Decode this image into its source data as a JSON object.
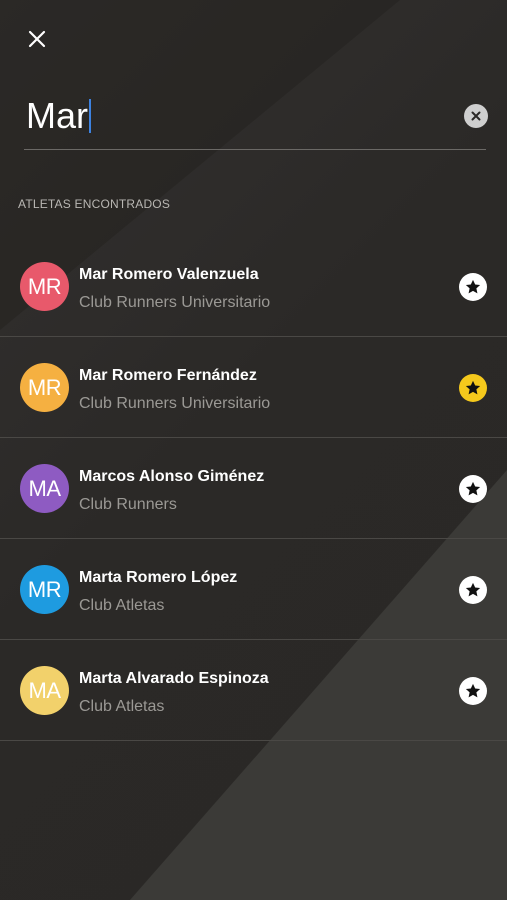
{
  "search": {
    "query": "Mar"
  },
  "section_title": "ATLETAS ENCONTRADOS",
  "athletes": [
    {
      "initials": "MR",
      "name": "Mar Romero Valenzuela",
      "club": "Club Runners Universitario",
      "avatar_color": "#e8596b",
      "favorite": false
    },
    {
      "initials": "MR",
      "name": "Mar Romero Fernández",
      "club": "Club Runners Universitario",
      "avatar_color": "#f5b041",
      "favorite": true
    },
    {
      "initials": "MA",
      "name": "Marcos Alonso Giménez",
      "club": "Club Runners",
      "avatar_color": "#8e5bc2",
      "favorite": false
    },
    {
      "initials": "MR",
      "name": "Marta Romero López",
      "club": "Club Atletas",
      "avatar_color": "#1e9be0",
      "favorite": false
    },
    {
      "initials": "MA",
      "name": "Marta Alvarado Espinoza",
      "club": "Club Atletas",
      "avatar_color": "#f2d16b",
      "favorite": false
    }
  ],
  "colors": {
    "favorite_on": "#f5c91c",
    "favorite_off": "#ffffff",
    "caret": "#3d82e0"
  },
  "icons": {
    "close": "close-icon",
    "clear": "clear-icon",
    "star": "star-icon"
  }
}
